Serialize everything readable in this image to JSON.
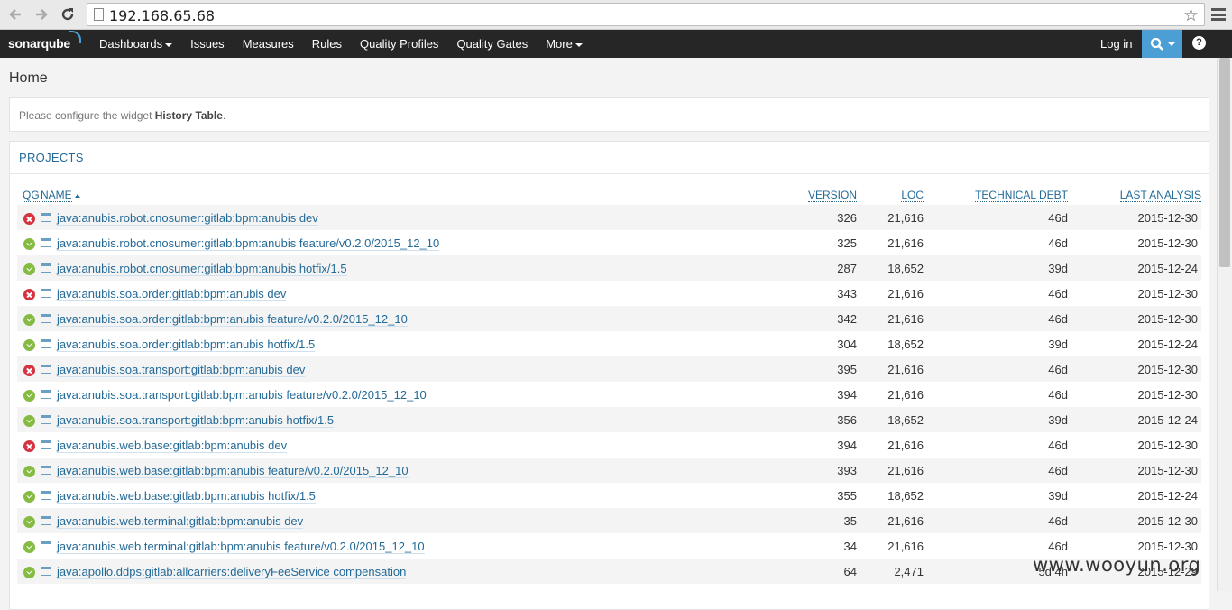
{
  "browser": {
    "url": "192.168.65.68"
  },
  "nav": {
    "logo": "sonarqube",
    "items": [
      {
        "label": "Dashboards",
        "dropdown": true
      },
      {
        "label": "Issues",
        "dropdown": false
      },
      {
        "label": "Measures",
        "dropdown": false
      },
      {
        "label": "Rules",
        "dropdown": false
      },
      {
        "label": "Quality Profiles",
        "dropdown": false
      },
      {
        "label": "Quality Gates",
        "dropdown": false
      },
      {
        "label": "More",
        "dropdown": true
      }
    ],
    "login": "Log in",
    "help": "?",
    "accent": "#4b9fd5"
  },
  "breadcrumb": "Home",
  "history_widget": {
    "prefix": "Please configure the widget ",
    "name": "History Table",
    "suffix": "."
  },
  "projects": {
    "title": "PROJECTS",
    "columns": {
      "qg": "QG",
      "name": "NAME",
      "version": "VERSION",
      "loc": "LOC",
      "debt": "TECHNICAL DEBT",
      "last": "LAST ANALYSIS"
    },
    "rows": [
      {
        "qg": "error",
        "name": "java:anubis.robot.cnosumer:gitlab:bpm:anubis dev",
        "version": "326",
        "loc": "21,616",
        "debt": "46d",
        "last": "2015-12-30"
      },
      {
        "qg": "ok",
        "name": "java:anubis.robot.cnosumer:gitlab:bpm:anubis feature/v0.2.0/2015_12_10",
        "version": "325",
        "loc": "21,616",
        "debt": "46d",
        "last": "2015-12-30"
      },
      {
        "qg": "ok",
        "name": "java:anubis.robot.cnosumer:gitlab:bpm:anubis hotfix/1.5",
        "version": "287",
        "loc": "18,652",
        "debt": "39d",
        "last": "2015-12-24"
      },
      {
        "qg": "error",
        "name": "java:anubis.soa.order:gitlab:bpm:anubis dev",
        "version": "343",
        "loc": "21,616",
        "debt": "46d",
        "last": "2015-12-30"
      },
      {
        "qg": "ok",
        "name": "java:anubis.soa.order:gitlab:bpm:anubis feature/v0.2.0/2015_12_10",
        "version": "342",
        "loc": "21,616",
        "debt": "46d",
        "last": "2015-12-30"
      },
      {
        "qg": "ok",
        "name": "java:anubis.soa.order:gitlab:bpm:anubis hotfix/1.5",
        "version": "304",
        "loc": "18,652",
        "debt": "39d",
        "last": "2015-12-24"
      },
      {
        "qg": "error",
        "name": "java:anubis.soa.transport:gitlab:bpm:anubis dev",
        "version": "395",
        "loc": "21,616",
        "debt": "46d",
        "last": "2015-12-30"
      },
      {
        "qg": "ok",
        "name": "java:anubis.soa.transport:gitlab:bpm:anubis feature/v0.2.0/2015_12_10",
        "version": "394",
        "loc": "21,616",
        "debt": "46d",
        "last": "2015-12-30"
      },
      {
        "qg": "ok",
        "name": "java:anubis.soa.transport:gitlab:bpm:anubis hotfix/1.5",
        "version": "356",
        "loc": "18,652",
        "debt": "39d",
        "last": "2015-12-24"
      },
      {
        "qg": "error",
        "name": "java:anubis.web.base:gitlab:bpm:anubis dev",
        "version": "394",
        "loc": "21,616",
        "debt": "46d",
        "last": "2015-12-30"
      },
      {
        "qg": "ok",
        "name": "java:anubis.web.base:gitlab:bpm:anubis feature/v0.2.0/2015_12_10",
        "version": "393",
        "loc": "21,616",
        "debt": "46d",
        "last": "2015-12-30"
      },
      {
        "qg": "ok",
        "name": "java:anubis.web.base:gitlab:bpm:anubis hotfix/1.5",
        "version": "355",
        "loc": "18,652",
        "debt": "39d",
        "last": "2015-12-24"
      },
      {
        "qg": "ok",
        "name": "java:anubis.web.terminal:gitlab:bpm:anubis dev",
        "version": "35",
        "loc": "21,616",
        "debt": "46d",
        "last": "2015-12-30"
      },
      {
        "qg": "ok",
        "name": "java:anubis.web.terminal:gitlab:bpm:anubis feature/v0.2.0/2015_12_10",
        "version": "34",
        "loc": "21,616",
        "debt": "46d",
        "last": "2015-12-30"
      },
      {
        "qg": "ok",
        "name": "java:apollo.ddps:gitlab:allcarriers:deliveryFeeService compensation",
        "version": "64",
        "loc": "2,471",
        "debt": "5d 4h",
        "last": "2015-12-29"
      }
    ]
  },
  "watermark": "www.wooyun.org"
}
